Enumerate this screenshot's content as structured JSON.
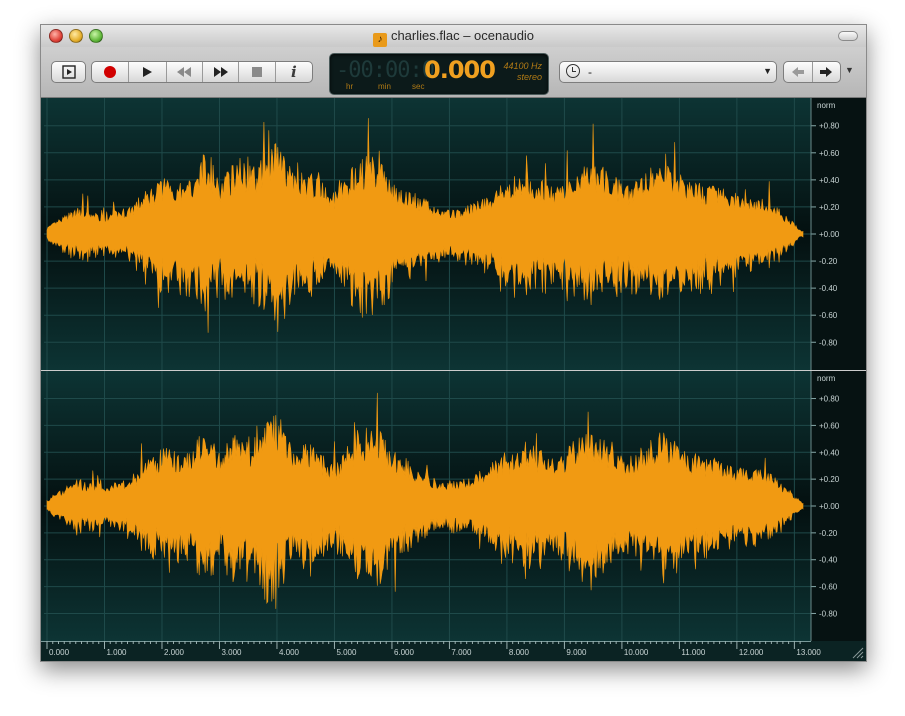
{
  "window": {
    "title": "charlies.flac – ocenaudio"
  },
  "toolbar": {
    "display": {
      "ghost_digits": "-00:00:0",
      "time": "0.000",
      "unit_hr": "hr",
      "unit_min": "min",
      "unit_sec": "sec",
      "sample_rate": "44100 Hz",
      "channels": "stereo"
    },
    "selection_combo": {
      "value": "-"
    },
    "info_label": "i"
  },
  "waveform": {
    "scale_header": "norm",
    "amplitude_ticks": [
      "+0.80",
      "+0.60",
      "+0.40",
      "+0.20",
      "+0.00",
      "-0.20",
      "-0.40",
      "-0.60",
      "-0.80"
    ],
    "time_ticks": [
      "0.000",
      "1.000",
      "2.000",
      "3.000",
      "4.000",
      "5.000",
      "6.000",
      "7.000",
      "8.000",
      "9.000",
      "10.000",
      "11.000",
      "12.000",
      "13.000"
    ],
    "colors": {
      "wave": "#f19a12",
      "background": "#0a2828"
    }
  }
}
